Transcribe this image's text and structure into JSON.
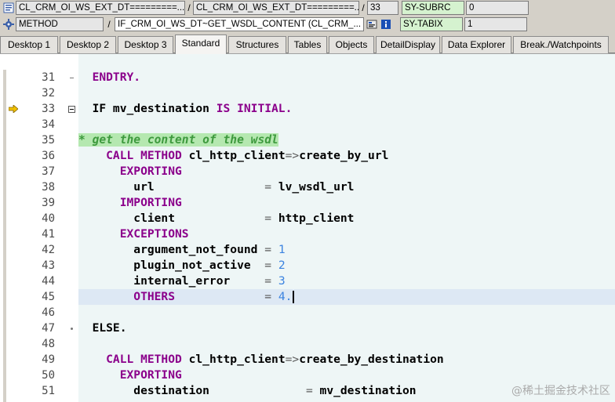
{
  "header": {
    "row1": {
      "field_a": "CL_CRM_OI_WS_EXT_DT=========...",
      "field_b": "CL_CRM_OI_WS_EXT_DT=========...",
      "line_no": "33",
      "sysvar_name": "SY-SUBRC",
      "sysvar_value": "0"
    },
    "row2": {
      "type_label": "METHOD",
      "method_name": "IF_CRM_OI_WS_DT~GET_WSDL_CONTENT (CL_CRM_...",
      "sysvar_name": "SY-TABIX",
      "sysvar_value": "1"
    },
    "separators": [
      "/",
      "/",
      "/"
    ]
  },
  "tabs": [
    {
      "label": "Desktop 1",
      "active": false
    },
    {
      "label": "Desktop 2",
      "active": false
    },
    {
      "label": "Desktop 3",
      "active": false
    },
    {
      "label": "Standard",
      "active": true
    },
    {
      "label": "Structures",
      "active": false
    },
    {
      "label": "Tables",
      "active": false
    },
    {
      "label": "Objects",
      "active": false
    },
    {
      "label": "DetailDisplay",
      "active": false
    },
    {
      "label": "Data Explorer",
      "active": false
    },
    {
      "label": "Break./Watchpoints",
      "active": false
    }
  ],
  "code_lines": [
    {
      "n": "31",
      "segs": [
        {
          "t": "  ENDTRY.",
          "c": "kw"
        }
      ]
    },
    {
      "n": "32",
      "segs": []
    },
    {
      "n": "33",
      "segs": [
        {
          "t": "  IF mv_destination ",
          "c": ""
        },
        {
          "t": "IS INITIAL.",
          "c": "kw"
        }
      ]
    },
    {
      "n": "34",
      "segs": []
    },
    {
      "n": "35",
      "segs": [
        {
          "t": "* get the content of the wsdl",
          "c": "cmt"
        }
      ]
    },
    {
      "n": "36",
      "segs": [
        {
          "t": "    CALL METHOD ",
          "c": "kw"
        },
        {
          "t": "cl_http_client",
          "c": ""
        },
        {
          "t": "=>",
          "c": "op"
        },
        {
          "t": "create_by_url",
          "c": ""
        }
      ]
    },
    {
      "n": "37",
      "segs": [
        {
          "t": "      EXPORTING",
          "c": "kw"
        }
      ]
    },
    {
      "n": "38",
      "segs": [
        {
          "t": "        url                ",
          "c": ""
        },
        {
          "t": "= ",
          "c": "op"
        },
        {
          "t": "lv_wsdl_url",
          "c": ""
        }
      ]
    },
    {
      "n": "39",
      "segs": [
        {
          "t": "      IMPORTING",
          "c": "kw"
        }
      ]
    },
    {
      "n": "40",
      "segs": [
        {
          "t": "        client             ",
          "c": ""
        },
        {
          "t": "= ",
          "c": "op"
        },
        {
          "t": "http_client",
          "c": ""
        }
      ]
    },
    {
      "n": "41",
      "segs": [
        {
          "t": "      EXCEPTIONS",
          "c": "kw"
        }
      ]
    },
    {
      "n": "42",
      "segs": [
        {
          "t": "        argument_not_found ",
          "c": ""
        },
        {
          "t": "= ",
          "c": "op"
        },
        {
          "t": "1",
          "c": "num"
        }
      ]
    },
    {
      "n": "43",
      "segs": [
        {
          "t": "        plugin_not_active  ",
          "c": ""
        },
        {
          "t": "= ",
          "c": "op"
        },
        {
          "t": "2",
          "c": "num"
        }
      ]
    },
    {
      "n": "44",
      "segs": [
        {
          "t": "        internal_error     ",
          "c": ""
        },
        {
          "t": "= ",
          "c": "op"
        },
        {
          "t": "3",
          "c": "num"
        }
      ]
    },
    {
      "n": "45",
      "segs": [
        {
          "t": "        OTHERS             ",
          "c": "kw"
        },
        {
          "t": "= ",
          "c": "op"
        },
        {
          "t": "4.",
          "c": "num"
        }
      ]
    },
    {
      "n": "46",
      "segs": []
    },
    {
      "n": "47",
      "segs": [
        {
          "t": "  ELSE.",
          "c": ""
        }
      ]
    },
    {
      "n": "48",
      "segs": []
    },
    {
      "n": "49",
      "segs": [
        {
          "t": "    CALL METHOD ",
          "c": "kw"
        },
        {
          "t": "cl_http_client",
          "c": ""
        },
        {
          "t": "=>",
          "c": "op"
        },
        {
          "t": "create_by_destination",
          "c": ""
        }
      ]
    },
    {
      "n": "50",
      "segs": [
        {
          "t": "      EXPORTING",
          "c": "kw"
        }
      ]
    },
    {
      "n": "51",
      "segs": [
        {
          "t": "        destination              ",
          "c": ""
        },
        {
          "t": "= ",
          "c": "op"
        },
        {
          "t": "mv_destination",
          "c": ""
        }
      ]
    }
  ],
  "current_line": "33",
  "highlighted_line": "45",
  "watermark": "@稀土掘金技术社区",
  "icons": {
    "row1": "source-code-icon",
    "row2": "method-icon",
    "nav": "navigate-icon",
    "info": "info-icon",
    "marker": "execution-arrow-icon",
    "fold": "fold-minus-icon"
  }
}
